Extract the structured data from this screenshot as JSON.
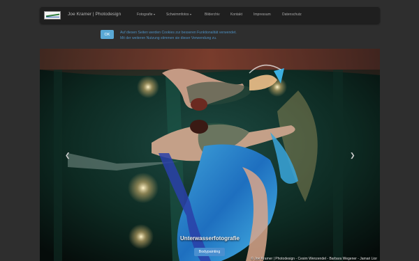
{
  "brand": "Joe Kramer | Photodesign",
  "nav": [
    {
      "label": "Fotografie",
      "dropdown": true
    },
    {
      "label": "Schwimmfotos",
      "dropdown": true
    },
    {
      "label": "Bilderchiv",
      "dropdown": false
    },
    {
      "label": "Kontakt",
      "dropdown": false
    },
    {
      "label": "Impressum",
      "dropdown": false
    },
    {
      "label": "Datenschutz",
      "dropdown": false
    }
  ],
  "cookie": {
    "ok_label": "OK",
    "line1": "Auf diesen Seiten werden Cookies zur besseren Funktionalität verwendet.",
    "line2": "Mit der weiteren Nutzung stimmen sie dieser Verwendung zu."
  },
  "slider": {
    "prev_icon": "chevron-left-icon",
    "next_icon": "chevron-right-icon",
    "caption_title": "Unterwasserfotografie",
    "caption_button": "Bodypainting",
    "credit": "© Joe Kramer | Photodesign - Cesim Wenzendel - Barbara Wegener - Jamari Lior"
  },
  "colors": {
    "page_bg": "#2e2e2e",
    "navbar_bg": "#1f1f1f",
    "ok_button": "#5aa9d6",
    "cookie_text": "#4d8fc0",
    "caption_button": "#4a8fd0"
  }
}
